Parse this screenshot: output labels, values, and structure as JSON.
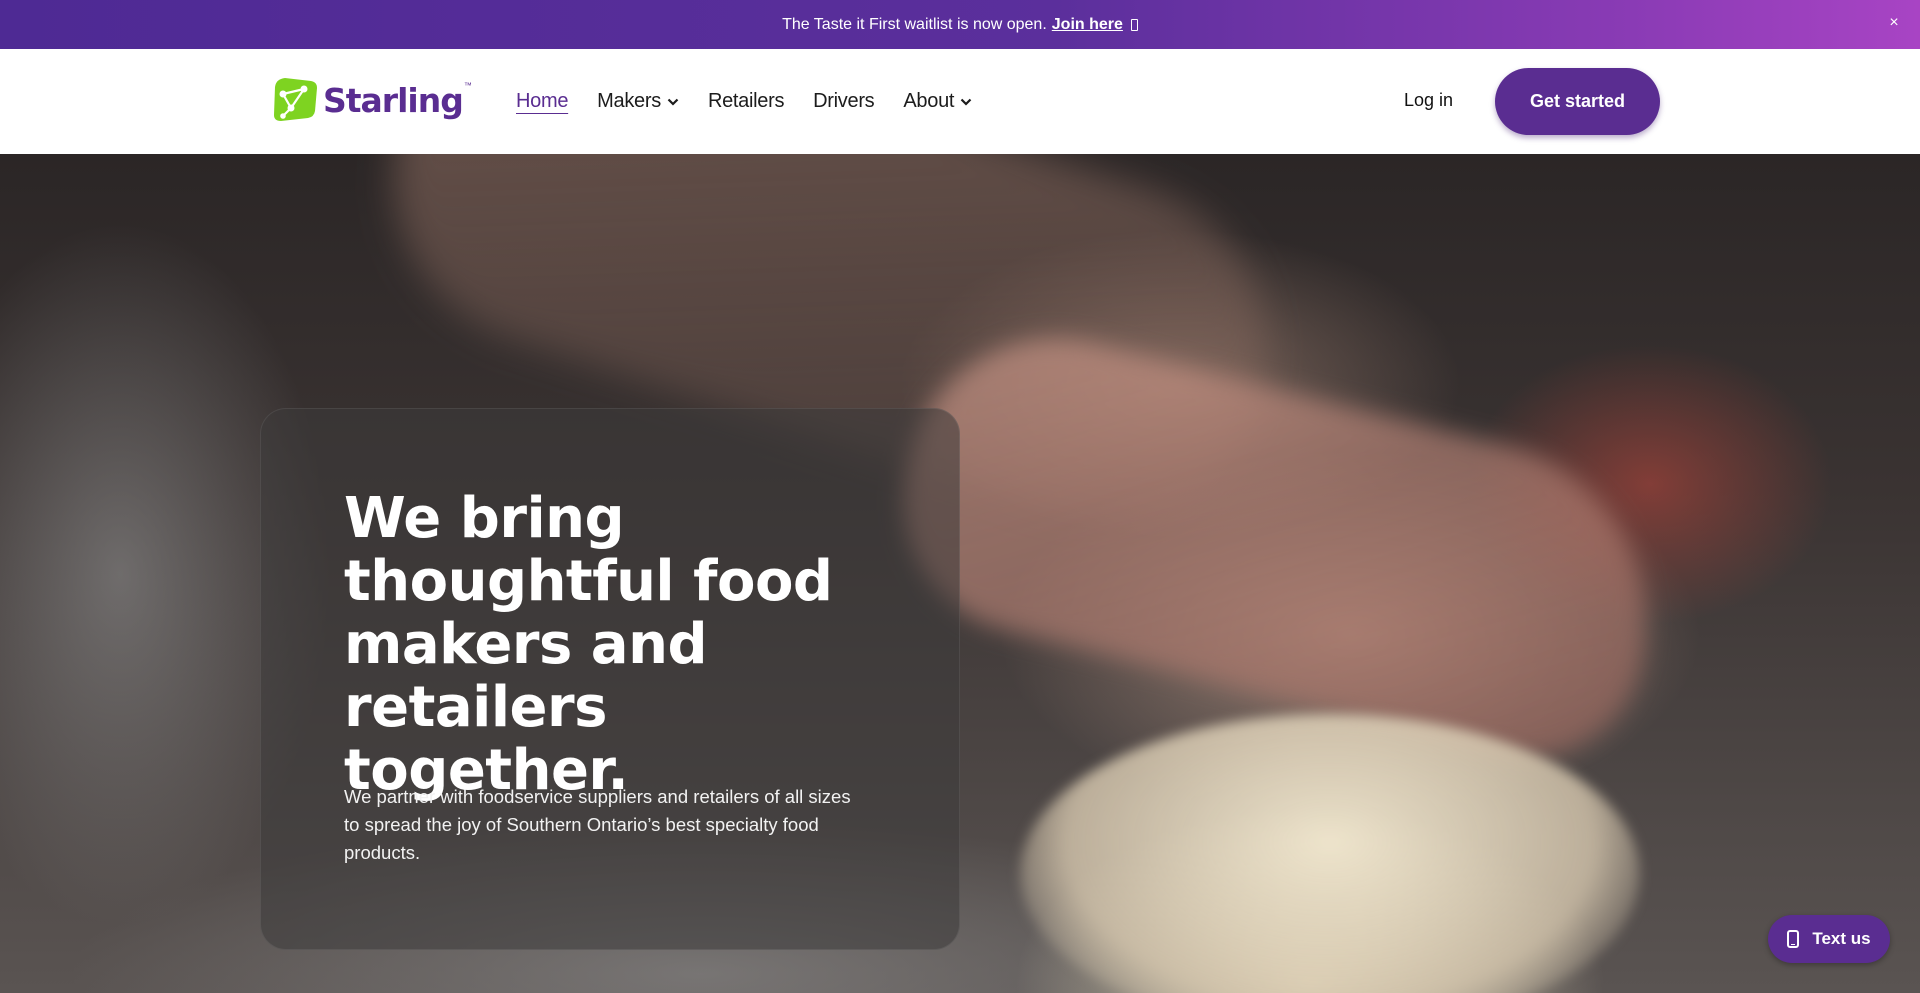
{
  "announcement": {
    "message": "The Taste it First waitlist is now open.",
    "link_label": "Join here",
    "close_label": "×"
  },
  "header": {
    "brand_name": "Starling",
    "brand_tm": "™",
    "nav": [
      {
        "label": "Home",
        "active": true,
        "has_dropdown": false
      },
      {
        "label": "Makers",
        "active": false,
        "has_dropdown": true
      },
      {
        "label": "Retailers",
        "active": false,
        "has_dropdown": false
      },
      {
        "label": "Drivers",
        "active": false,
        "has_dropdown": false
      },
      {
        "label": "About",
        "active": false,
        "has_dropdown": true
      }
    ],
    "login_label": "Log in",
    "cta_label": "Get started"
  },
  "hero": {
    "headline": "We bring thoughtful food makers and retailers together.",
    "description": "We partner with foodservice suppliers and retailers of all sizes to spread the joy of Southern Ontario’s best specialty food products."
  },
  "chat_widget": {
    "label": "Text us",
    "icon": "phone-icon"
  },
  "colors": {
    "brand_purple": "#5a2d91",
    "logo_green": "#7ed321",
    "banner_gradient_start": "#4e2a94",
    "banner_gradient_end": "#a844c4"
  }
}
